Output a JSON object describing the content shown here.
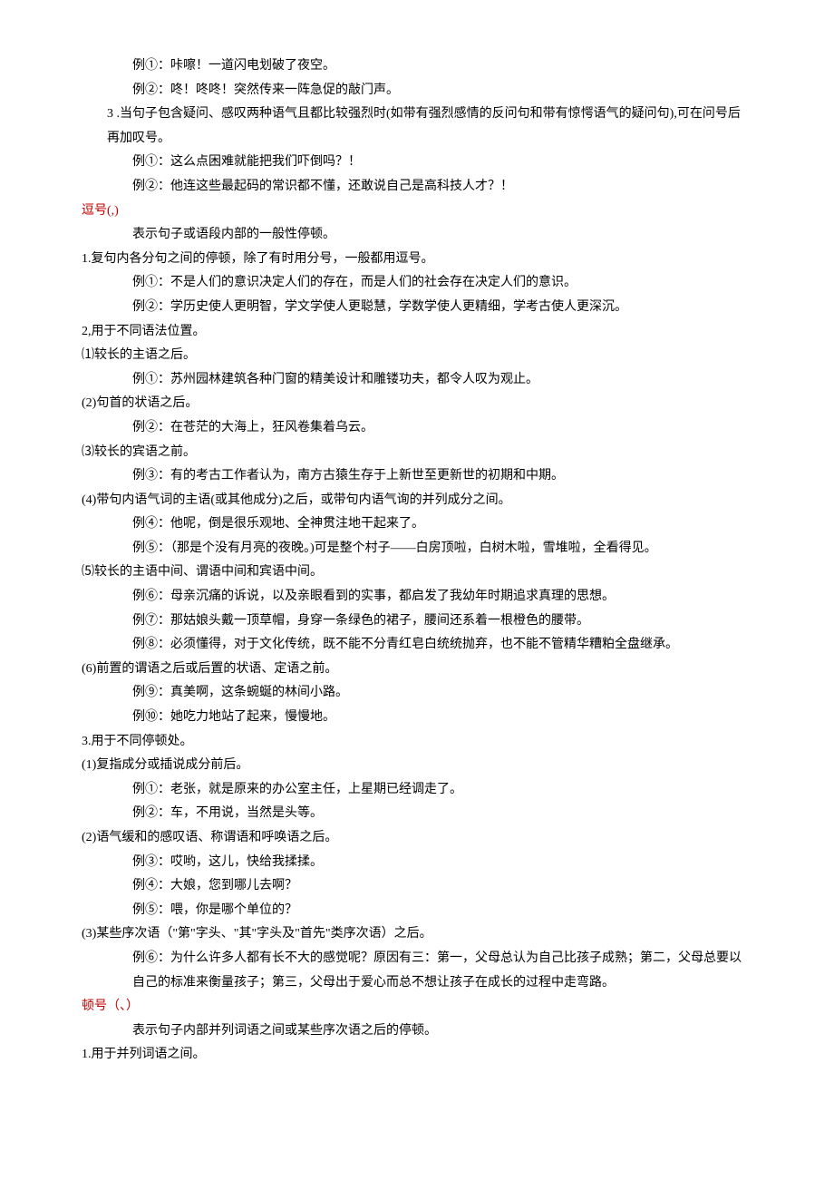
{
  "lines": [
    {
      "cls": "indent2",
      "text": "例①：咔嚓！一道闪电划破了夜空。"
    },
    {
      "cls": "indent2",
      "text": "例②：咚！咚咚！突然传来一阵急促的敲门声。"
    },
    {
      "cls": "indent1 num-wide",
      "text": "3  .当句子包含疑问、感叹两种语气且都比较强烈时(如带有强烈感情的反问句和带有惊愕语气的疑问句),可在问号后再加叹号。"
    },
    {
      "cls": "indent2",
      "text": "例①：这么点困难就能把我们吓倒吗？！"
    },
    {
      "cls": "indent2",
      "text": "例②：他连这些最起码的常识都不懂，还敢说自己是高科技人才？！"
    },
    {
      "cls": "red",
      "text": "逗号(,)"
    },
    {
      "cls": "indent2",
      "text": "表示句子或语段内部的一般性停顿。"
    },
    {
      "cls": "",
      "text": "1.复句内各分句之间的停顿，除了有时用分号，一般都用逗号。"
    },
    {
      "cls": "indent2",
      "text": "例①：不是人们的意识决定人们的存在，而是人们的社会存在决定人们的意识。"
    },
    {
      "cls": "indent2",
      "text": "例②：学历史使人更明智，学文学使人更聪慧，学数学使人更精细，学考古使人更深沉。"
    },
    {
      "cls": "",
      "text": "2,用于不同语法位置。"
    },
    {
      "cls": "",
      "text": "⑴较长的主语之后。"
    },
    {
      "cls": "indent2",
      "text": "例①：苏州园林建筑各种门窗的精美设计和雕镂功夫，都令人叹为观止。"
    },
    {
      "cls": "",
      "text": "(2)句首的状语之后。"
    },
    {
      "cls": "indent2",
      "text": "例②：在苍茫的大海上，狂风卷集着乌云。"
    },
    {
      "cls": "",
      "text": "⑶较长的宾语之前。"
    },
    {
      "cls": "indent2",
      "text": "例③：有的考古工作者认为，南方古猿生存于上新世至更新世的初期和中期。"
    },
    {
      "cls": "",
      "text": "(4)带句内语气词的主语(或其他成分)之后，或带句内语气询的并列成分之间。"
    },
    {
      "cls": "indent2",
      "text": "例④：他呢，倒是很乐观地、全神贯注地干起来了。"
    },
    {
      "cls": "indent2",
      "text": "例⑤：（那是个没有月亮的夜晚。)可是整个村子——白房顶啦，白树木啦，雪堆啦，全看得见。"
    },
    {
      "cls": "",
      "text": "⑸较长的主语中间、谓语中间和宾语中间。"
    },
    {
      "cls": "indent2",
      "text": "例⑥：母亲沉痛的诉说，以及亲眼看到的实事，都启发了我幼年时期追求真理的思想。"
    },
    {
      "cls": "indent2",
      "text": "例⑦：那姑娘头戴一顶草帽，身穿一条绿色的裙子，腰间还系着一根橙色的腰带。"
    },
    {
      "cls": "indent2",
      "text": "例⑧：必须懂得，对于文化传统，既不能不分青红皂白统统抛弃，也不能不管精华糟粕全盘继承。"
    },
    {
      "cls": "",
      "text": "(6)前置的谓语之后或后置的状语、定语之前。"
    },
    {
      "cls": "indent2",
      "text": "例⑨：真美啊，这条蜿蜒的林间小路。"
    },
    {
      "cls": "indent2",
      "text": "例⑩：她吃力地站了起来，慢慢地。"
    },
    {
      "cls": "",
      "text": "3.用于不同停顿处。"
    },
    {
      "cls": "",
      "text": "(1)复指成分或插说成分前后。"
    },
    {
      "cls": "indent2",
      "text": "例①：老张，就是原来的办公室主任，上星期已经调走了。"
    },
    {
      "cls": "indent2",
      "text": "例②：车，不用说，当然是头等。"
    },
    {
      "cls": "",
      "text": "(2)语气缓和的感叹语、称谓语和呼唤语之后。"
    },
    {
      "cls": "indent2",
      "text": "例③：哎哟，这儿，快给我揉揉。"
    },
    {
      "cls": "indent2",
      "text": "例④：大娘，您到哪儿去啊？"
    },
    {
      "cls": "indent2",
      "text": "例⑤：喂，你是哪个单位的？"
    },
    {
      "cls": "",
      "text": "(3)某些序次语（\"第\"字头、\"其\"字头及\"首先\"类序次语）之后。"
    },
    {
      "cls": "indent2",
      "text": "例⑥：为什么许多人都有长不大的感觉呢？原因有三：第一，父母总认为自己比孩子成熟；第二，父母总要以自己的标准来衡量孩子；第三，父母出于爱心而总不想让孩子在成长的过程中走弯路。"
    },
    {
      "cls": "red",
      "text": "顿号（、）"
    },
    {
      "cls": "indent2",
      "text": "表示句子内部并列词语之间或某些序次语之后的停顿。"
    },
    {
      "cls": "",
      "text": "1.用于并列词语之间。"
    }
  ]
}
